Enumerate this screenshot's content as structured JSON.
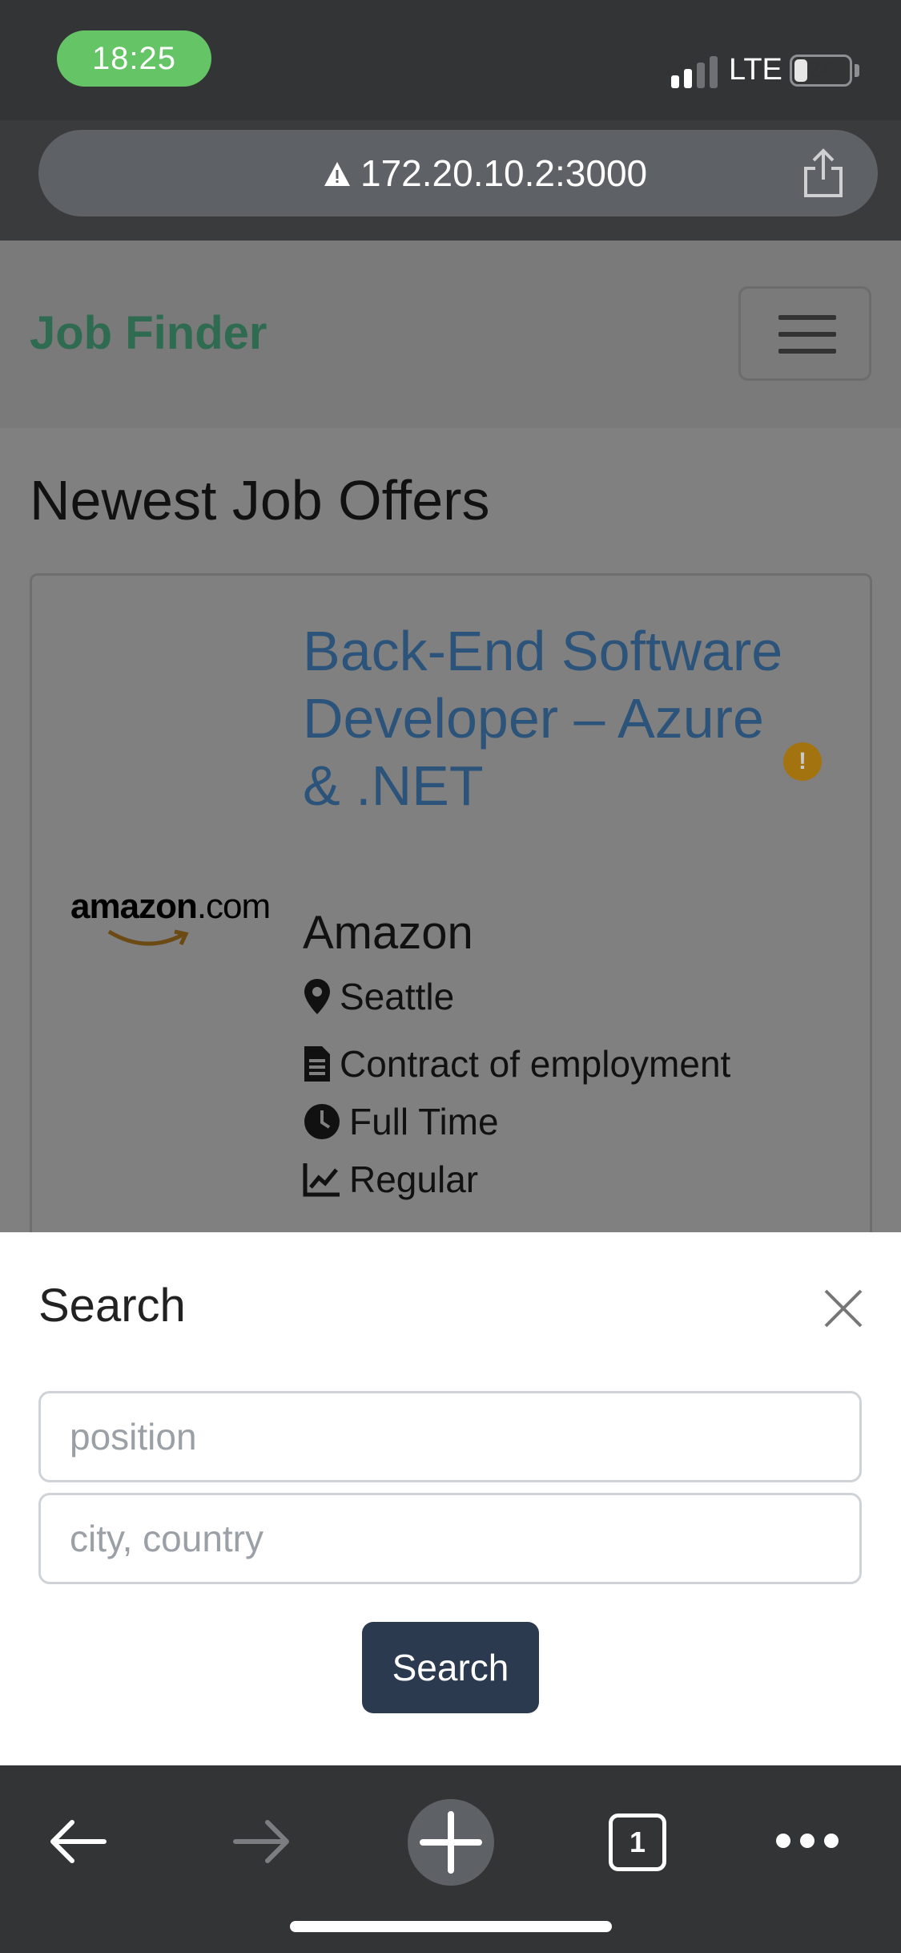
{
  "status_bar": {
    "time": "18:25",
    "network": "LTE",
    "battery": "24",
    "battery_level": 0.24
  },
  "browser": {
    "url": "172.20.10.2:3000",
    "url_icon": "warning-icon",
    "share_icon": "share-icon",
    "tab_count": "1"
  },
  "navbar": {
    "brand": "Job Finder",
    "menu_icon": "hamburger-icon"
  },
  "main": {
    "section_title": "Newest Job Offers",
    "offers": [
      {
        "logo_text": "amazon",
        "logo_suffix": ".com",
        "title": "Back-End Software Developer – Azure & .NET",
        "badge": "!",
        "company": "Amazon",
        "location": "Seattle",
        "contract": "Contract of employment",
        "schedule": "Full Time",
        "level": "Regular"
      }
    ]
  },
  "search_modal": {
    "title": "Search",
    "position_placeholder": "position",
    "location_placeholder": "city, country",
    "search_button": "Search"
  },
  "colors": {
    "brand": "#2e6b51",
    "job_title": "#2c5379",
    "button": "#2c3a4f",
    "status_pill": "#65c466"
  }
}
